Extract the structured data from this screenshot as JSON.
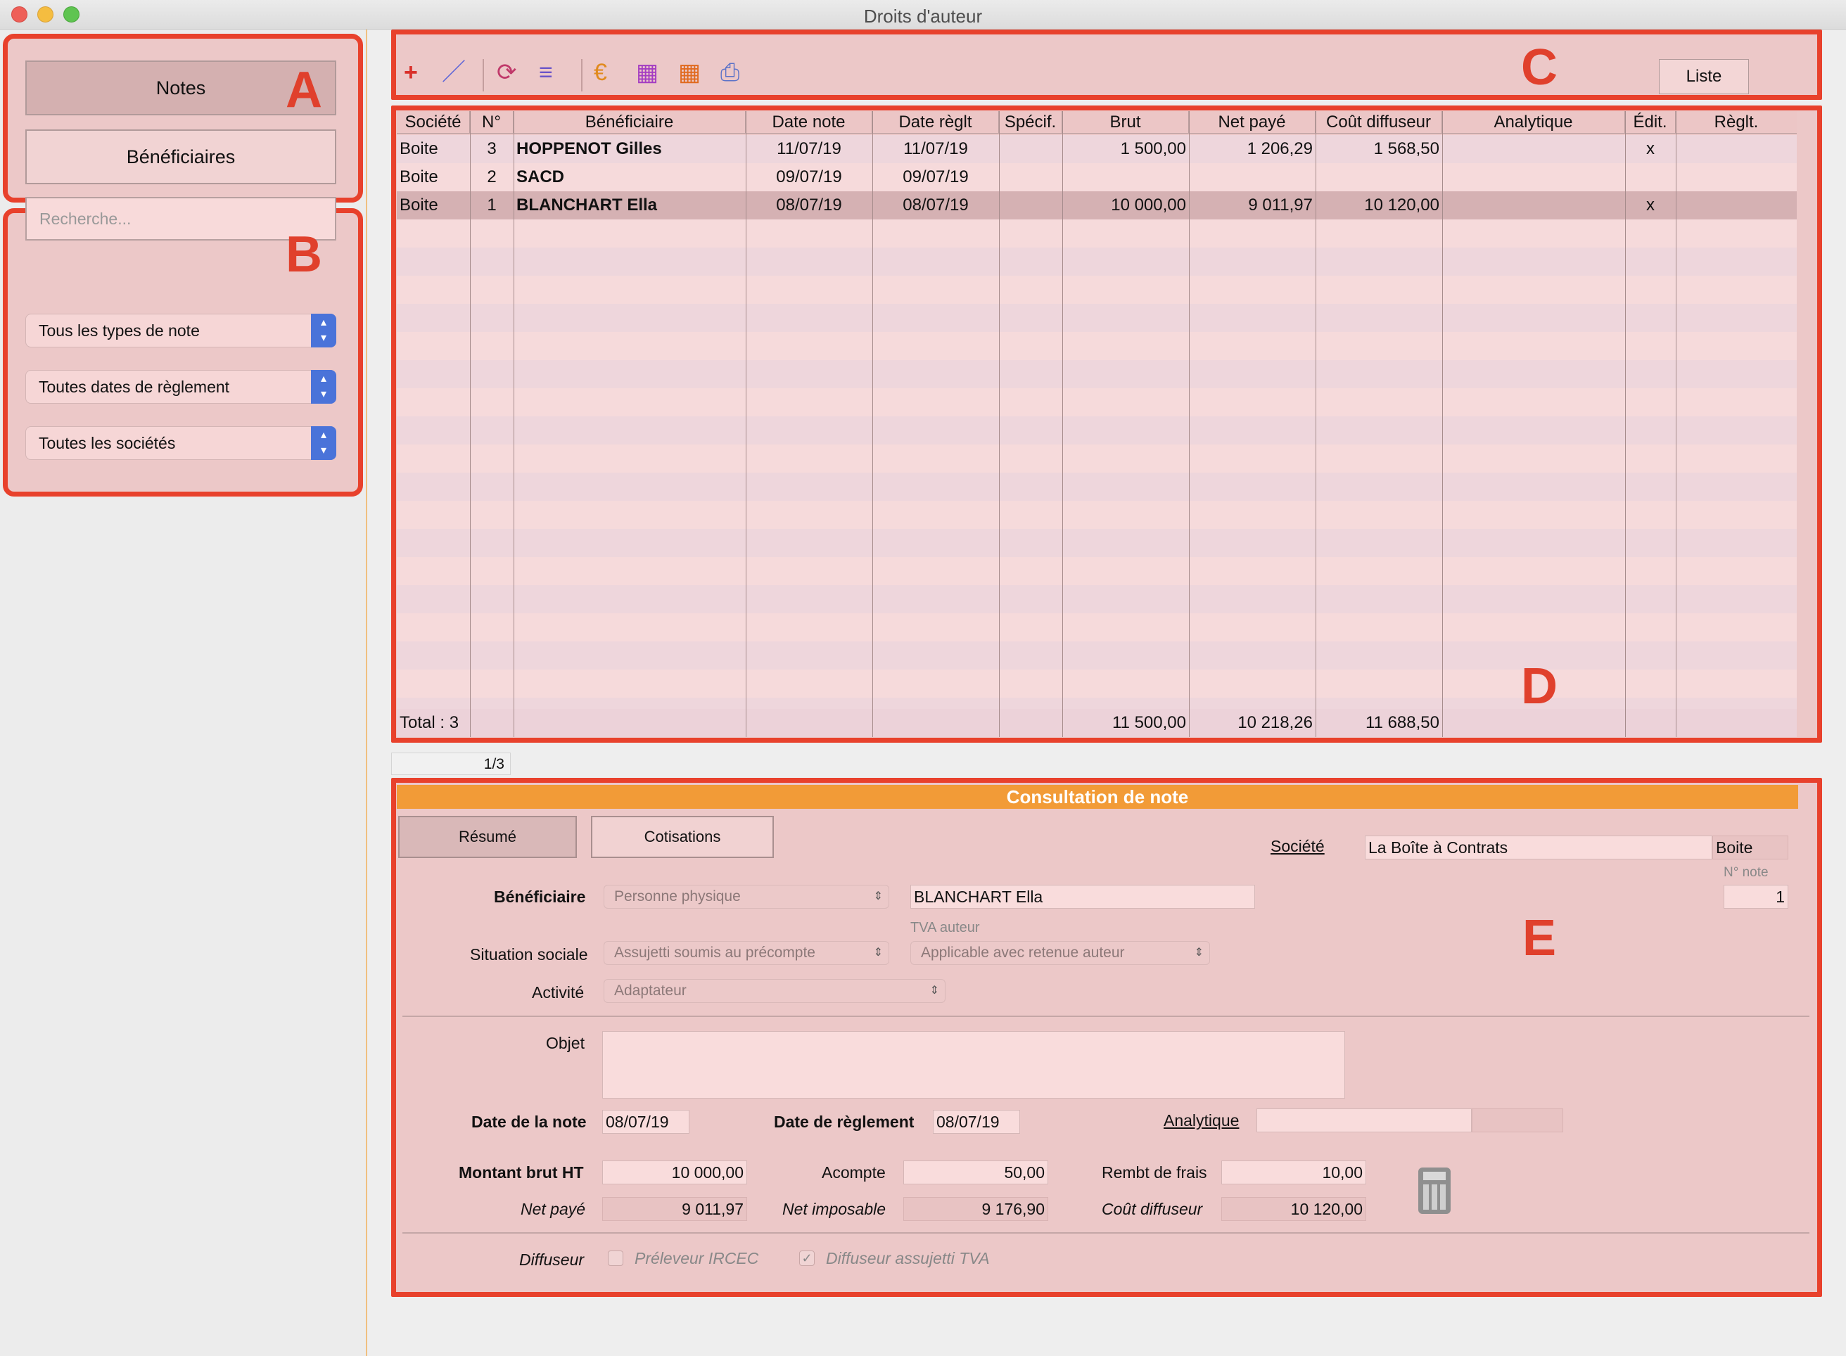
{
  "window": {
    "title": "Droits d'auteur"
  },
  "sidebar": {
    "nav": {
      "notes": "Notes",
      "beneficiaires": "Bénéficiaires"
    },
    "search": {
      "placeholder": "Recherche..."
    },
    "filters": {
      "type": "Tous les types de note",
      "date": "Toutes dates de règlement",
      "societe": "Toutes les sociétés"
    }
  },
  "annotations": {
    "a": "A",
    "b": "B",
    "c": "C",
    "d": "D",
    "e": "E"
  },
  "toolbar": {
    "liste_label": "Liste"
  },
  "table": {
    "columns": [
      "Société",
      "N°",
      "Bénéficiaire",
      "Date note",
      "Date règlt",
      "Spécif.",
      "Brut",
      "Net payé",
      "Coût diffuseur",
      "Analytique",
      "Édit.",
      "Règlt."
    ],
    "rows": [
      {
        "societe": "Boite",
        "num": "3",
        "beneficiaire": "HOPPENOT Gilles",
        "date_note": "11/07/19",
        "date_reglt": "11/07/19",
        "specif": "",
        "brut": "1 500,00",
        "net": "1 206,29",
        "cout": "1 568,50",
        "analytique": "",
        "edit": "x",
        "reglt": ""
      },
      {
        "societe": "Boite",
        "num": "2",
        "beneficiaire": "SACD",
        "date_note": "09/07/19",
        "date_reglt": "09/07/19",
        "specif": "",
        "brut": "",
        "net": "",
        "cout": "",
        "analytique": "",
        "edit": "",
        "reglt": ""
      },
      {
        "societe": "Boite",
        "num": "1",
        "beneficiaire": "BLANCHART Ella",
        "date_note": "08/07/19",
        "date_reglt": "08/07/19",
        "specif": "",
        "brut": "10 000,00",
        "net": "9 011,97",
        "cout": "10 120,00",
        "analytique": "",
        "edit": "x",
        "reglt": ""
      }
    ],
    "total": {
      "label": "Total : 3",
      "brut": "11 500,00",
      "net": "10 218,26",
      "cout": "11 688,50"
    },
    "pager": "1/3"
  },
  "form": {
    "header": "Consultation de note",
    "tabs": {
      "resume": "Résumé",
      "cotisations": "Cotisations"
    },
    "societe_label": "Société",
    "societe_value": "La Boîte à Contrats",
    "societe_code": "Boite",
    "num_note_label": "N° note",
    "num_note_value": "1",
    "beneficiaire_label": "Bénéficiaire",
    "beneficiaire_type": "Personne physique",
    "beneficiaire_name": "BLANCHART Ella",
    "tva_label": "TVA auteur",
    "situation_label": "Situation sociale",
    "situation_value": "Assujetti soumis au précompte",
    "tva_value": "Applicable avec retenue auteur",
    "activite_label": "Activité",
    "activite_value": "Adaptateur",
    "objet_label": "Objet",
    "objet_value": "",
    "date_note_label": "Date de la note",
    "date_note_value": "08/07/19",
    "date_reglement_label": "Date de règlement",
    "date_reglement_value": "08/07/19",
    "analytique_label": "Analytique",
    "montant_label": "Montant brut HT",
    "montant_value": "10 000,00",
    "acompte_label": "Acompte",
    "acompte_value": "50,00",
    "rembt_label": "Rembt de frais",
    "rembt_value": "10,00",
    "net_paye_label": "Net payé",
    "net_paye_value": "9 011,97",
    "net_imposable_label": "Net imposable",
    "net_imposable_value": "9 176,90",
    "cout_label": "Coût diffuseur",
    "cout_value": "10 120,00",
    "diffuseur_label": "Diffuseur",
    "preleveur_label": "Préleveur IRCEC",
    "assujetti_label": "Diffuseur assujetti TVA"
  },
  "colors": {
    "accent_red": "#e8412c",
    "orange_header": "#f29b37",
    "popup_blue": "#4a73d9"
  }
}
